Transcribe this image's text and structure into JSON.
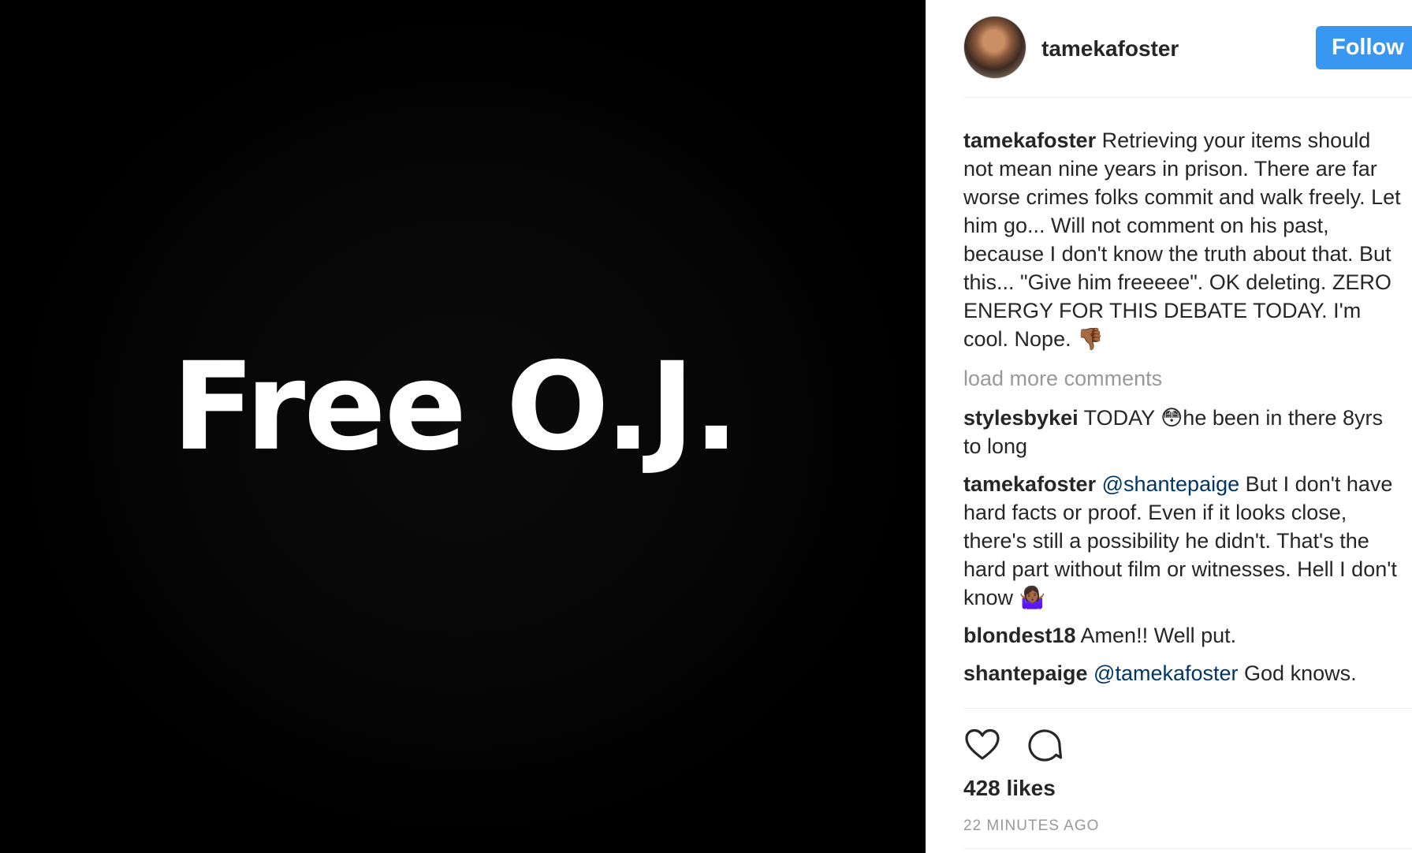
{
  "media": {
    "text": "Free O.J."
  },
  "header": {
    "username": "tamekafoster",
    "follow_label": "Follow"
  },
  "caption": {
    "author": "tamekafoster",
    "text": " Retrieving your items should not mean nine years in prison. There are far worse crimes folks commit and walk freely. Let him go... Will not comment on his past, because I don't know the truth about that. But this... \"Give him freeeee\". OK deleting. ZERO ENERGY FOR THIS DEBATE TODAY. I'm cool. Nope. 👎🏾"
  },
  "load_more": "load more comments",
  "comments": [
    {
      "author": "stylesbykei",
      "mention": "",
      "text": " TODAY 😳he been in there 8yrs to long"
    },
    {
      "author": "tamekafoster",
      "mention": " @shantepaige",
      "text": " But I don't have hard facts or proof. Even if it looks close, there's still a possibility he didn't. That's the hard part without film or witnesses. Hell I don't know 🤷🏾‍♀️"
    },
    {
      "author": "blondest18",
      "mention": "",
      "text": " Amen!! Well put."
    },
    {
      "author": "shantepaige",
      "mention": " @tamekafoster",
      "text": " God knows."
    }
  ],
  "actions": {
    "like_icon": "heart-outline",
    "comment_icon": "speech-bubble-outline"
  },
  "likes": "428 likes",
  "timestamp": "22 MINUTES AGO",
  "colors": {
    "follow_button": "#3897f0",
    "mention": "#003569",
    "muted": "#999999",
    "text": "#262626"
  }
}
